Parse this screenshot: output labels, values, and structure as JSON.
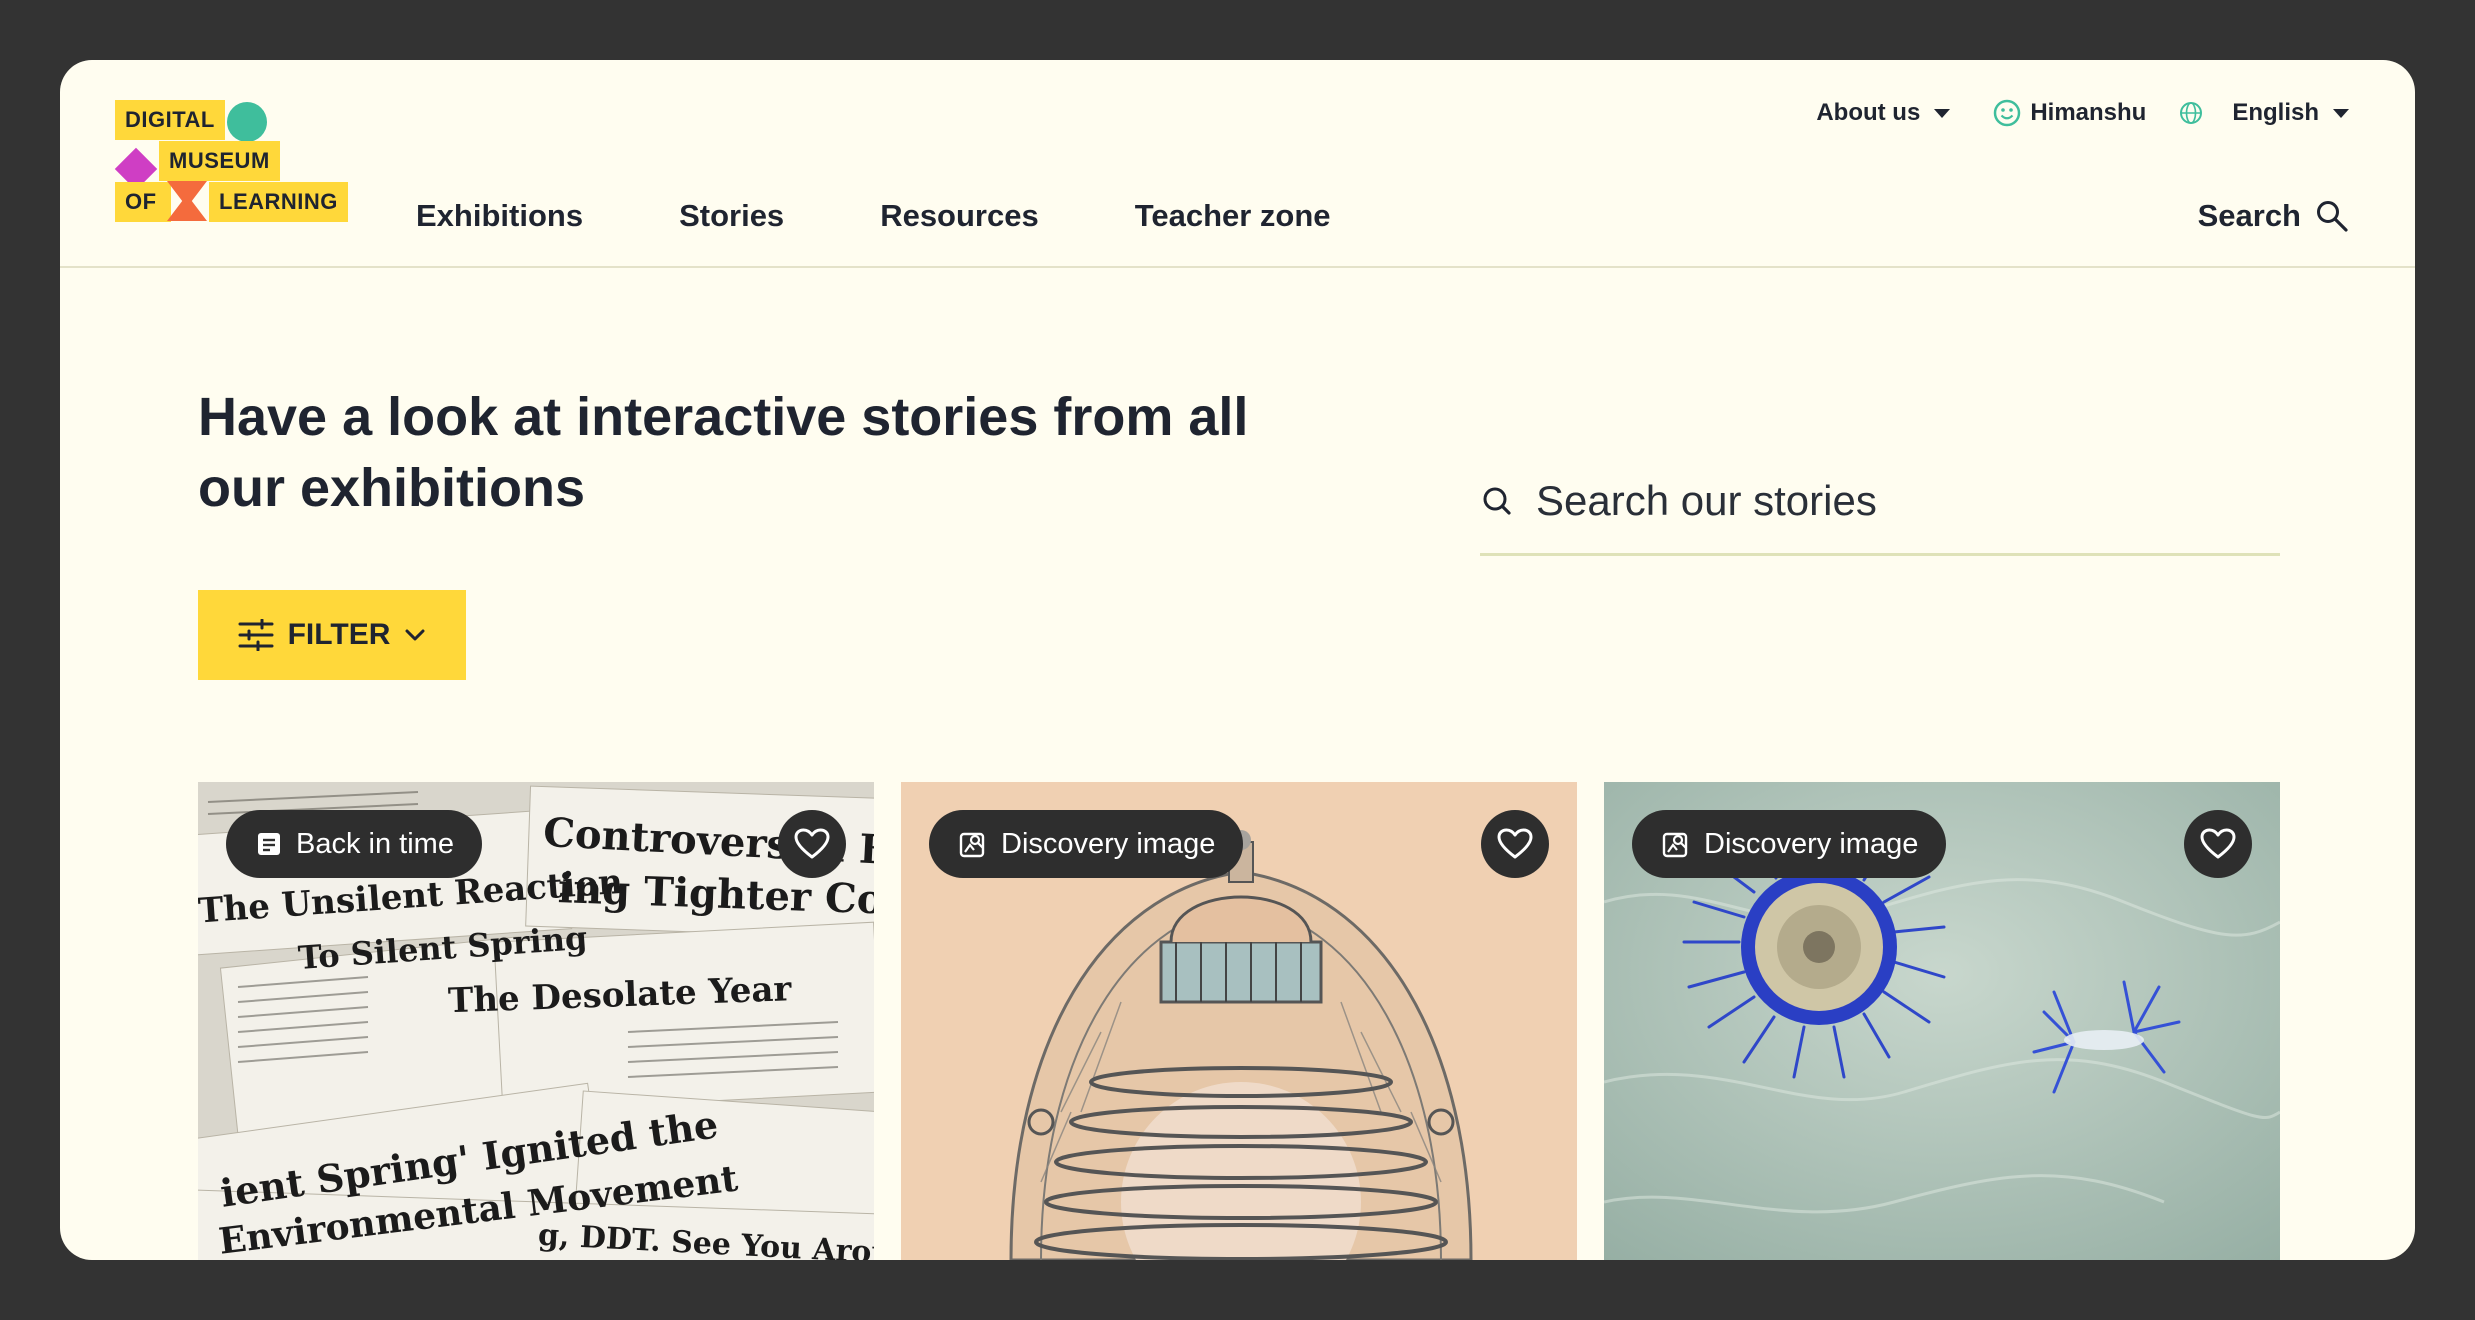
{
  "logo": {
    "line1": "DIGITAL",
    "line2": "MUSEUM",
    "line3a": "OF",
    "line3b": "LEARNING"
  },
  "topbar": {
    "about": "About us",
    "user": "Himanshu",
    "language": "English"
  },
  "nav": {
    "items": [
      {
        "label": "Exhibitions"
      },
      {
        "label": "Stories"
      },
      {
        "label": "Resources"
      },
      {
        "label": "Teacher zone"
      }
    ]
  },
  "header_search": {
    "label": "Search"
  },
  "main": {
    "headline": "Have a look at interactive stories from all our exhibitions",
    "search_placeholder": "Search our stories",
    "filter_label": "FILTER"
  },
  "cards": [
    {
      "badge": "Back in time",
      "badge_icon": "document-icon",
      "image": "newspaper-clippings"
    },
    {
      "badge": "Discovery image",
      "badge_icon": "image-search-icon",
      "image": "tower-illustration"
    },
    {
      "badge": "Discovery image",
      "badge_icon": "image-search-icon",
      "image": "blue-jellyfish"
    }
  ],
  "colors": {
    "accent_yellow": "#ffd83a",
    "page_bg": "#fffdf0",
    "dark": "#2e2e2e",
    "teal": "#3fbe9c"
  }
}
